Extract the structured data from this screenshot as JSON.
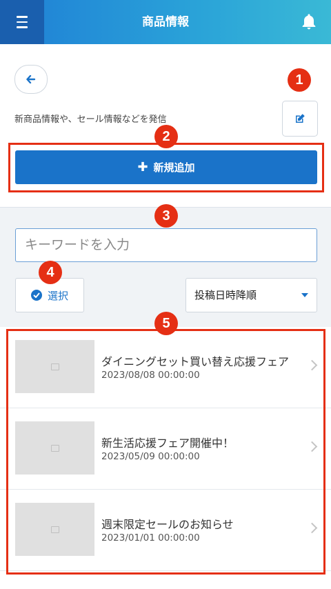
{
  "header": {
    "title": "商品情報",
    "menu_icon": "menu-icon",
    "bell_icon": "bell-icon",
    "accent_color": "#1f7fd6"
  },
  "top": {
    "description": "新商品情報や、セール情報などを発信",
    "add_label": "新規追加",
    "back_icon": "arrow-left-icon",
    "edit_icon": "edit-icon"
  },
  "search": {
    "placeholder": "キーワードを入力"
  },
  "controls": {
    "select_label": "選択",
    "sort_value": "投稿日時降順"
  },
  "items": [
    {
      "title": "ダイニングセット買い替え応援フェア",
      "date": "2023/08/08 00:00:00"
    },
    {
      "title": "新生活応援フェア開催中！",
      "date": "2023/05/09 00:00:00"
    },
    {
      "title": "週末限定セールのお知らせ",
      "date": "2023/01/01 00:00:00"
    }
  ],
  "annotations": {
    "b1": "1",
    "b2": "2",
    "b3": "3",
    "b4": "4",
    "b5": "5",
    "color": "#e52f14"
  }
}
